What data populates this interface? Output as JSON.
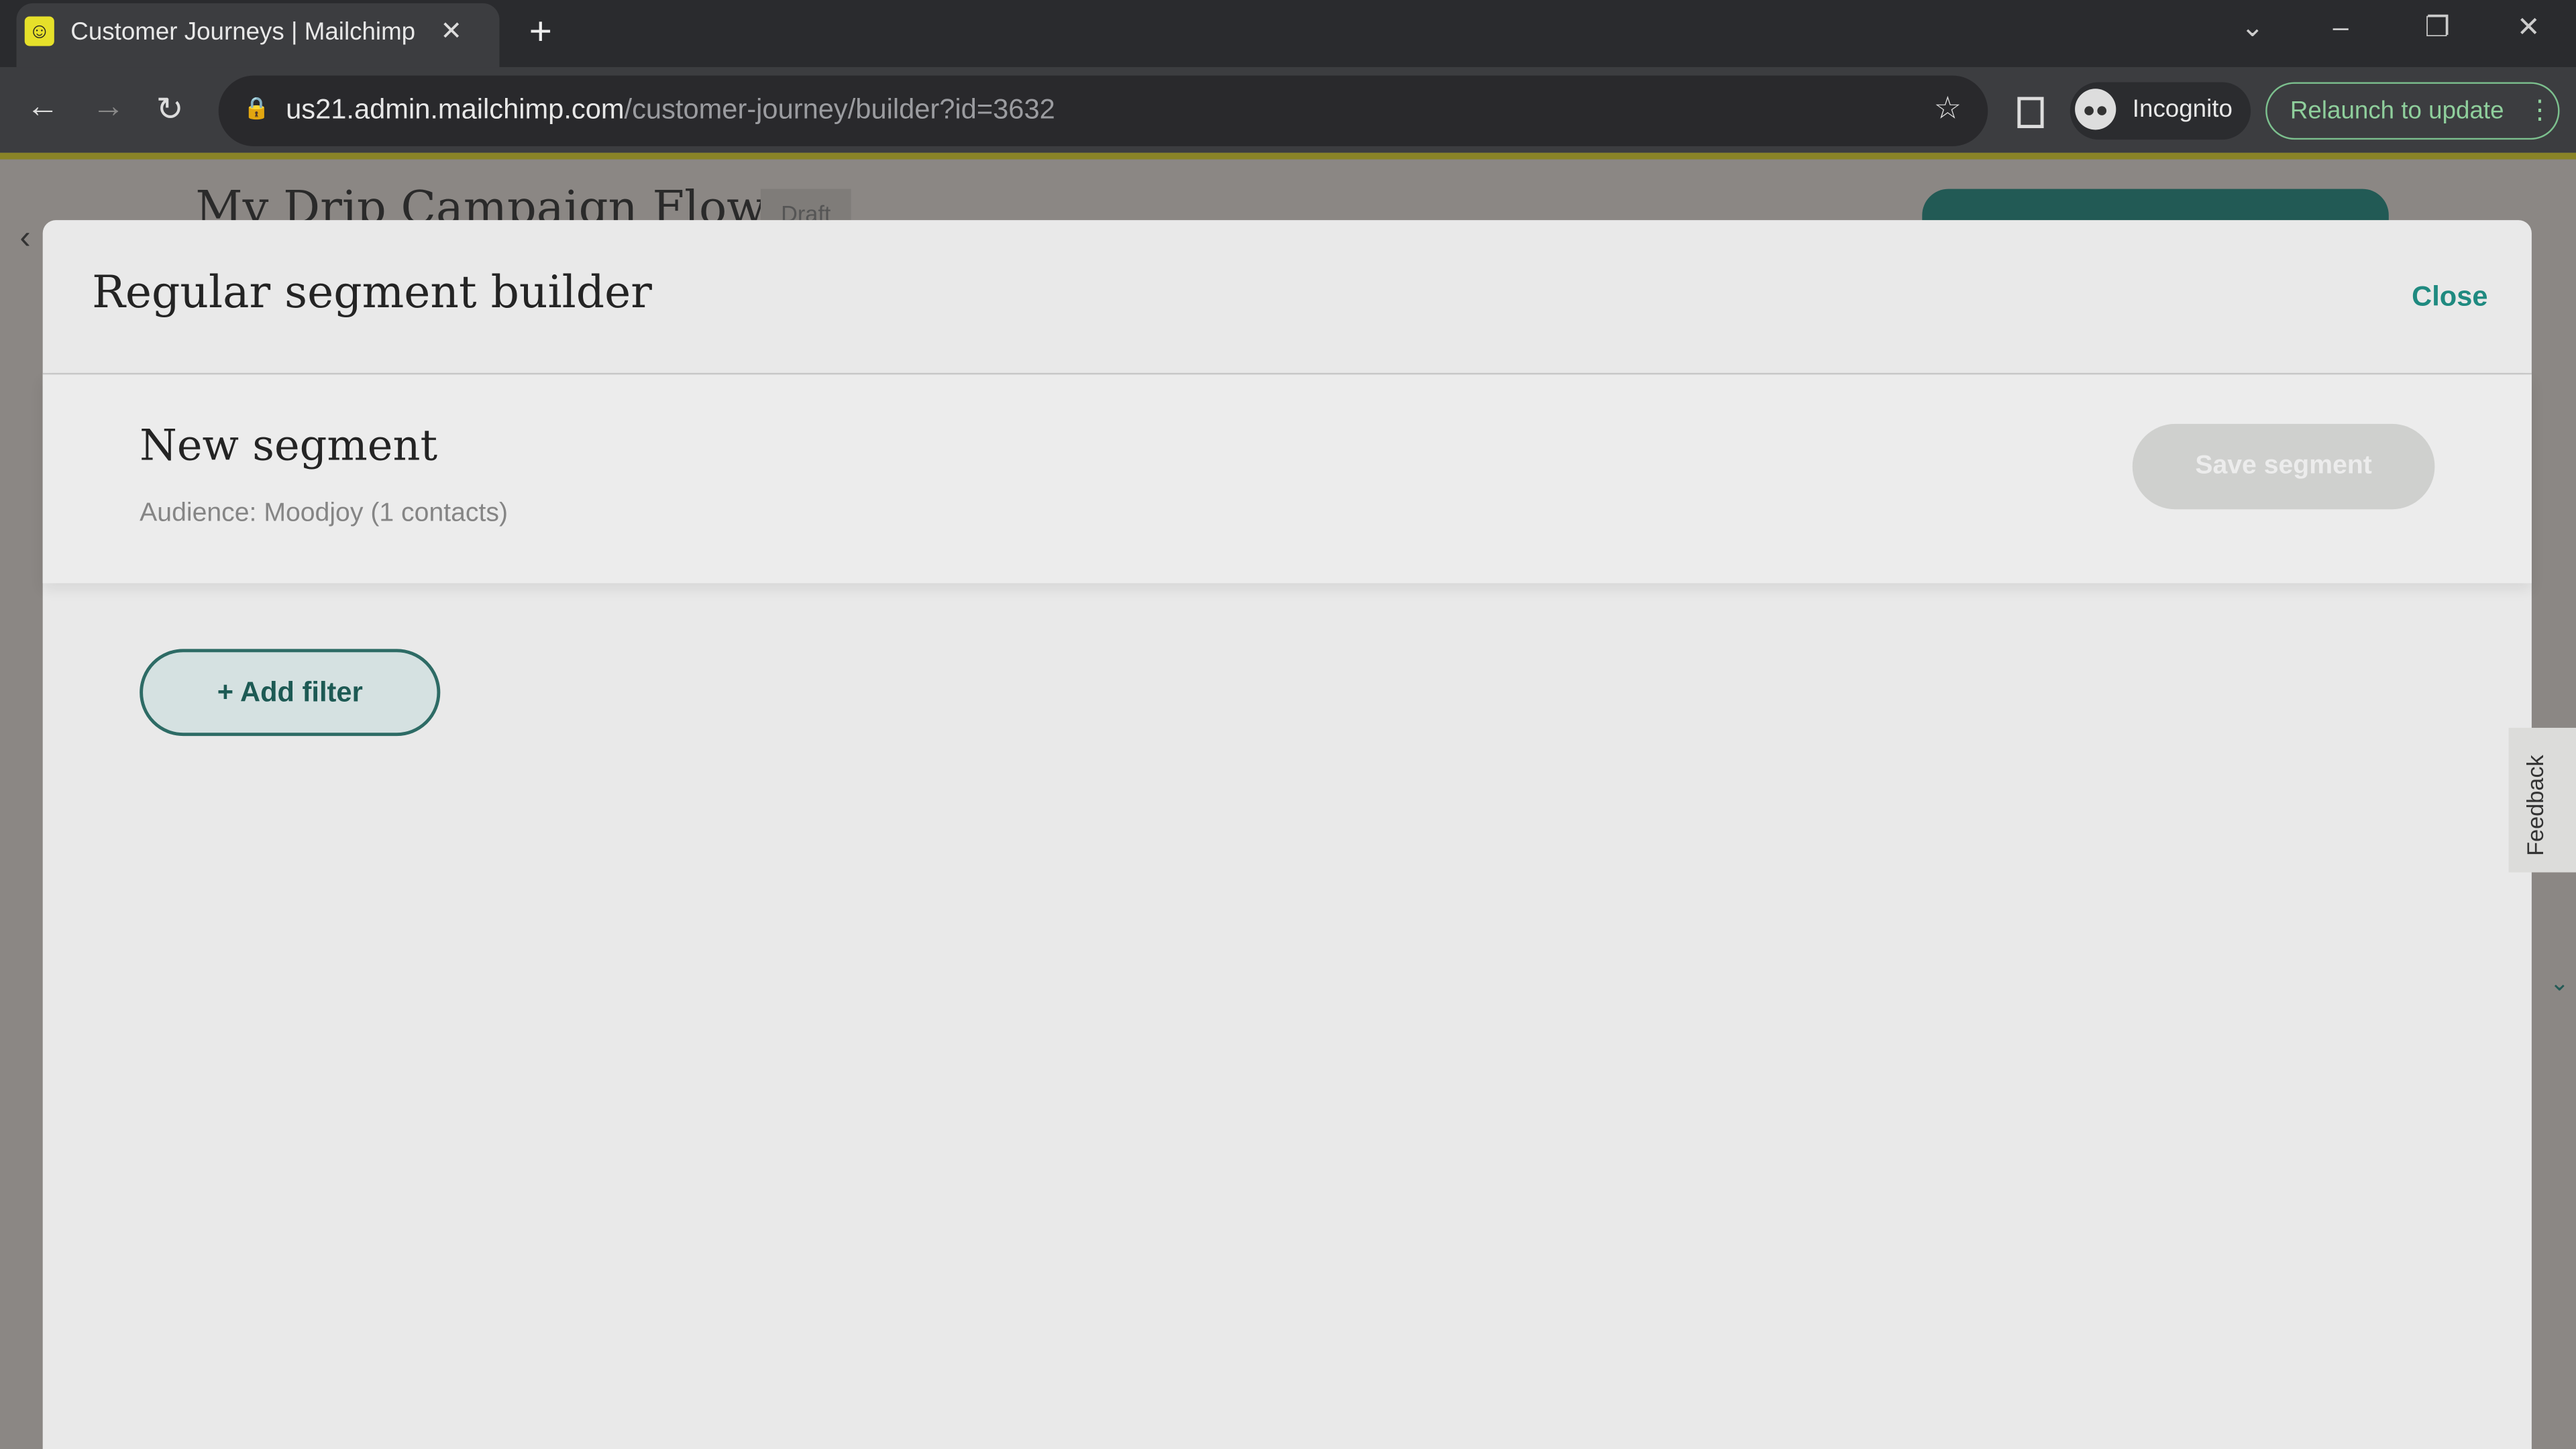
{
  "browser": {
    "tab_title": "Customer Journeys | Mailchimp",
    "url_host": "us21.admin.mailchimp.com",
    "url_path": "/customer-journey/builder?id=3632",
    "profile_label": "Incognito",
    "relaunch_label": "Relaunch to update"
  },
  "background_page": {
    "title": "My Drip Campaign Flow",
    "status_badge": "Draft"
  },
  "modal": {
    "title": "Regular segment builder",
    "close_label": "Close",
    "segment_name": "New segment",
    "audience_text": "Audience: Moodjoy (1 contacts)",
    "save_label": "Save segment",
    "add_filter_label": "Add filter"
  },
  "feedback_label": "Feedback",
  "colors": {
    "accent": "#1f8a80",
    "button_teal": "#225a55",
    "disabled": "#cfd0ce"
  }
}
